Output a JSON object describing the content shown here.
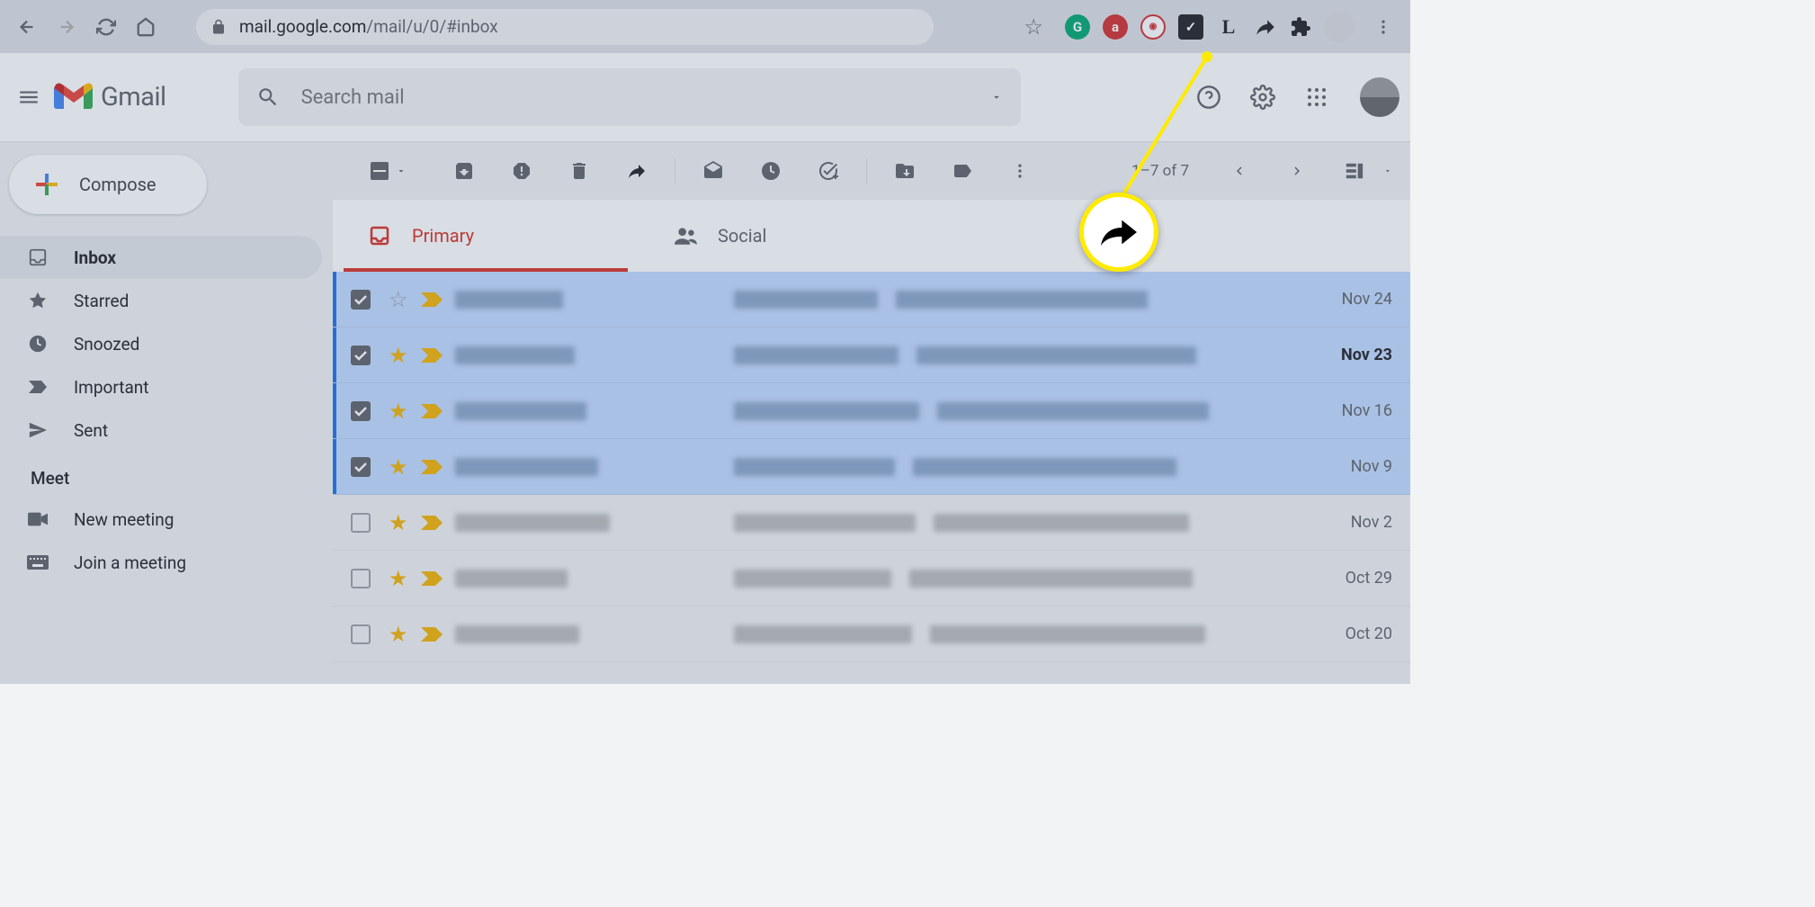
{
  "browser": {
    "url_domain": "mail.google.com",
    "url_path": "/mail/u/0/#inbox",
    "extensions": [
      {
        "name": "grammarly",
        "bg": "#00a870",
        "letter": "G"
      },
      {
        "name": "adblock",
        "bg": "#d32f2f",
        "letter": "a"
      },
      {
        "name": "opera",
        "bg": "#fff",
        "letter": ""
      },
      {
        "name": "checkmark",
        "bg": "#202124",
        "letter": "✓"
      },
      {
        "name": "L",
        "bg": "transparent",
        "letter": "L"
      }
    ]
  },
  "gmail": {
    "brand": "Gmail",
    "search_placeholder": "Search mail"
  },
  "sidebar": {
    "compose": "Compose",
    "items": [
      {
        "label": "Inbox",
        "icon": "inbox"
      },
      {
        "label": "Starred",
        "icon": "star"
      },
      {
        "label": "Snoozed",
        "icon": "clock"
      },
      {
        "label": "Important",
        "icon": "important"
      },
      {
        "label": "Sent",
        "icon": "send"
      }
    ],
    "meet_header": "Meet",
    "meet_items": [
      {
        "label": "New meeting",
        "icon": "video"
      },
      {
        "label": "Join a meeting",
        "icon": "keyboard"
      }
    ]
  },
  "toolbar": {
    "pagecount": "1–7 of 7"
  },
  "tabs": [
    {
      "label": "Primary",
      "icon": "inbox",
      "active": true
    },
    {
      "label": "Social",
      "icon": "people",
      "active": false
    }
  ],
  "emails": [
    {
      "selected": true,
      "starred": false,
      "date": "Nov 24",
      "bold": false
    },
    {
      "selected": true,
      "starred": true,
      "date": "Nov 23",
      "bold": true
    },
    {
      "selected": true,
      "starred": true,
      "date": "Nov 16",
      "bold": false
    },
    {
      "selected": true,
      "starred": true,
      "date": "Nov 9",
      "bold": false
    },
    {
      "selected": false,
      "starred": true,
      "date": "Nov 2",
      "bold": false
    },
    {
      "selected": false,
      "starred": true,
      "date": "Oct 29",
      "bold": false
    },
    {
      "selected": false,
      "starred": true,
      "date": "Oct 20",
      "bold": false
    }
  ]
}
